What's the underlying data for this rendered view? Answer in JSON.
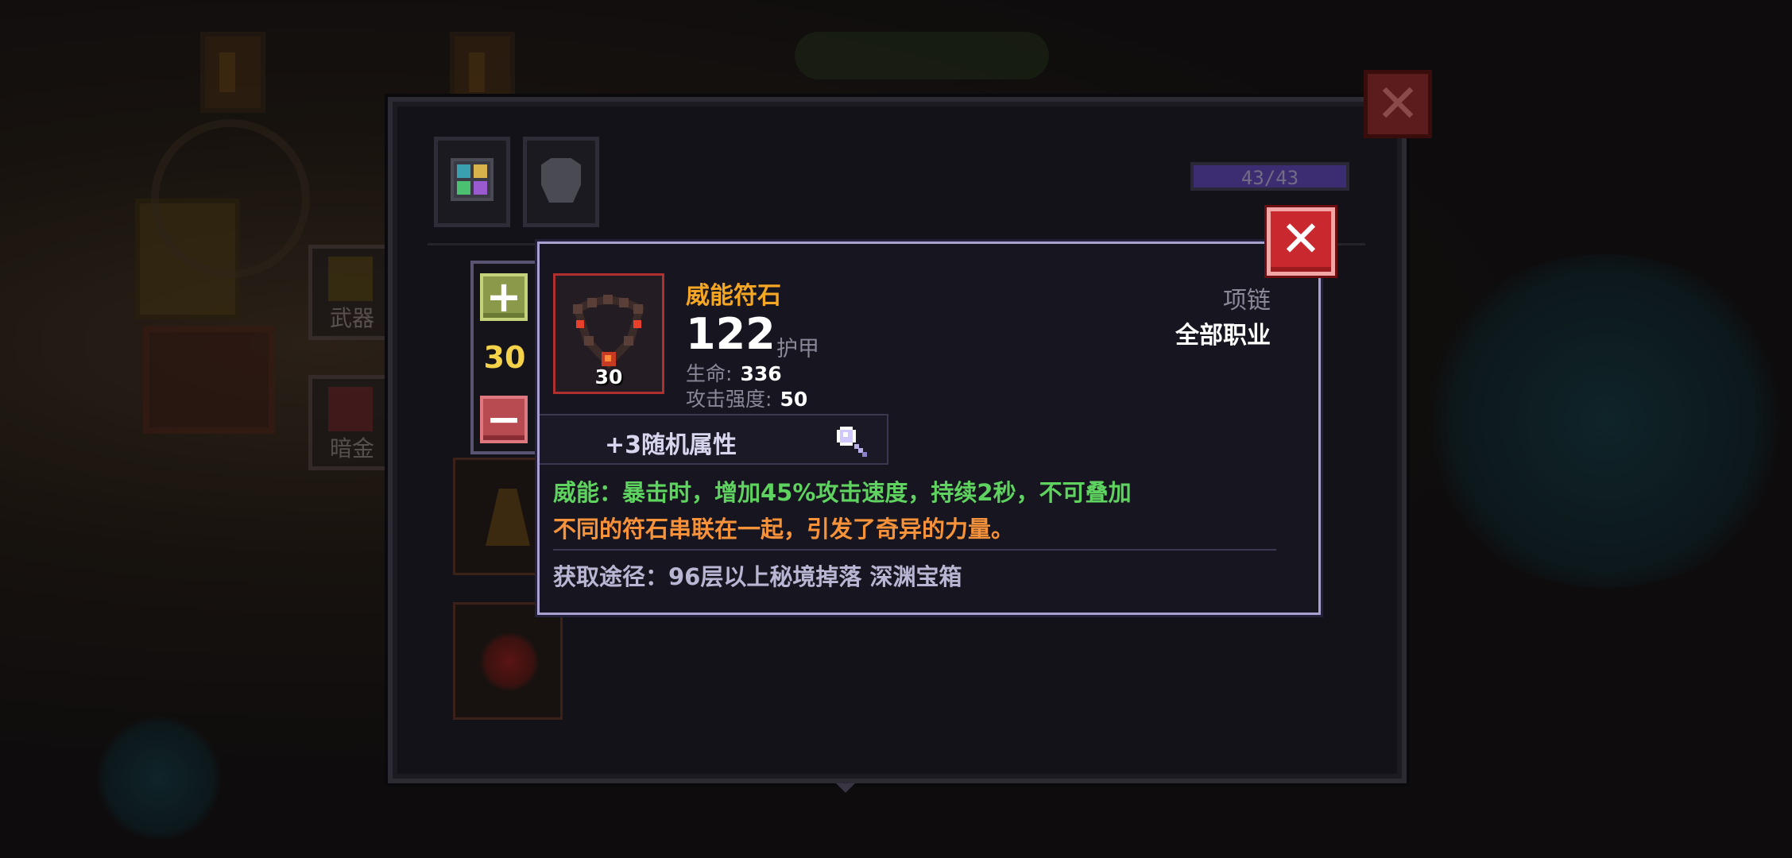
{
  "inventory": {
    "capacity": {
      "text": "43/43",
      "fill": 1.0
    }
  },
  "background": {
    "side_buttons": [
      {
        "label": "武器"
      },
      {
        "label": "暗金"
      }
    ]
  },
  "stepper": {
    "plus_label": "+",
    "minus_label": "−",
    "level": "30"
  },
  "item": {
    "name": "威能符石",
    "level": "30",
    "armor_value": "122",
    "armor_label": "护甲",
    "stats": [
      {
        "label": "生命:",
        "value": "336"
      },
      {
        "label": "攻击强度:",
        "value": "50"
      }
    ],
    "slot_type": "项链",
    "class_requirement": "全部职业",
    "random_attributes": "+3随机属性",
    "effect_text": "威能：暴击时，增加45%攻击速度，持续2秒，不可叠加",
    "flavor_text": "不同的符石串联在一起，引发了奇异的力量。",
    "source_text": "获取途径：96层以上秘境掉落 深渊宝箱"
  },
  "colors": {
    "item_name": "#f5a623",
    "effect": "#5fd35f",
    "flavor": "#f5923a",
    "level": "#f4d24a",
    "close_red": "#c8282e",
    "panel_border": "#a8a0ce"
  },
  "icons": {
    "window_close": "close-icon",
    "tooltip_close": "close-icon",
    "magnify": "magnifier-icon",
    "item": "rune-necklace-icon",
    "tab_1": "grid-icon",
    "tab_2": "armor-icon"
  }
}
